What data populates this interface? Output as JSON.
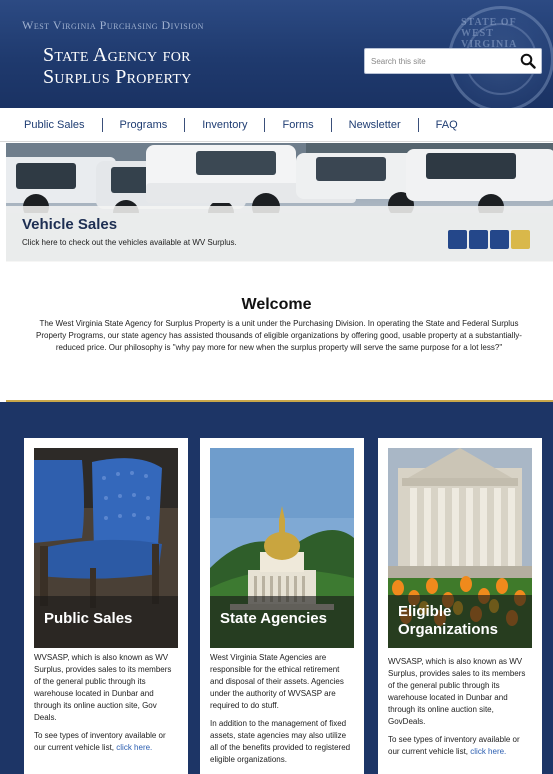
{
  "header": {
    "division": "West Virginia Purchasing Division",
    "agency_line1": "State Agency for",
    "agency_line2": "Surplus Property",
    "seal_text": "STATE OF WEST VIRGINIA",
    "search": {
      "placeholder": "Search this site",
      "icon": "magnifier-icon"
    }
  },
  "nav": {
    "items": [
      {
        "label": "Public Sales"
      },
      {
        "label": "Programs"
      },
      {
        "label": "Inventory"
      },
      {
        "label": "Forms"
      },
      {
        "label": "Newsletter"
      },
      {
        "label": "FAQ"
      }
    ]
  },
  "hero": {
    "title": "Vehicle Sales",
    "subtitle": "Click here to check out the vehicles available at WV Surplus.",
    "slides": 4,
    "active_slide": 4,
    "slide_color": "#24478a",
    "active_color": "#d9b84a"
  },
  "welcome": {
    "heading": "Welcome",
    "text": "The West Virginia State Agency for Surplus Property is a unit under the Purchasing Division. In operating the State and Federal Surplus Property Programs, our state agency has assisted thousands of eligible organizations by offering good, usable property at a substantially-reduced price. Our philosophy is \"why pay more for new when the surplus property will serve the same purpose for a lot less?\""
  },
  "cards": [
    {
      "title": "Public Sales",
      "paragraphs": [
        "WVSASP, which is also known as WV Surplus, provides sales to its members of the general public through its warehouse located in Dunbar and through its online auction site, Gov Deals."
      ],
      "link_prefix": "To see types of inventory available or our current vehicle list, ",
      "link_text": "click here."
    },
    {
      "title": "State Agencies",
      "paragraphs": [
        "West Virginia State Agencies are responsible for the ethical retirement and disposal of their assets. Agencies under the authority of WVSASP are required to do stuff.",
        "In addition to the management of fixed assets, state agencies may also utilize all of the benefits provided to registered eligible organizations."
      ]
    },
    {
      "title_line1": "Eligible",
      "title_line2": "Organizations",
      "paragraphs": [
        "WVSASP, which is also known as WV Surplus, provides sales to its members of the general public through its warehouse located in Dunbar and through its online auction site, GovDeals."
      ],
      "link_prefix": "To see types of inventory available or our current vehicle list, ",
      "link_text": "click here."
    }
  ],
  "colors": {
    "header_blue": "#1f3a6e",
    "nav_text": "#1e3c72",
    "cards_bg": "#1d3566",
    "gold": "#c9a74a",
    "link": "#2a5db0"
  }
}
